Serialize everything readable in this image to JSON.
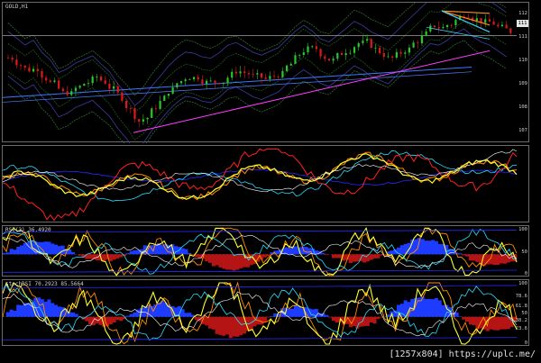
{
  "window": {
    "title": "GOLD,H1"
  },
  "chart_data": [
    {
      "type": "candlestick",
      "name": "price",
      "title": "GOLD,H1",
      "y_ticks": [
        "112",
        "111",
        "110",
        "109",
        "108",
        "107"
      ],
      "ylim": [
        106.6,
        112.3
      ],
      "last_price": "111",
      "close": [
        110.1,
        109.8,
        109.5,
        109.7,
        109.2,
        108.9,
        108.4,
        108.6,
        108.9,
        109.1,
        109.3,
        109.0,
        108.7,
        108.2,
        107.8,
        107.3,
        107.6,
        108.1,
        108.5,
        108.9,
        109.2,
        109.4,
        109.3,
        109.1,
        109.0,
        109.2,
        109.5,
        109.6,
        109.4,
        109.2,
        109.1,
        109.3,
        109.5,
        109.9,
        110.3,
        110.6,
        110.4,
        110.1,
        110.0,
        110.3,
        110.6,
        110.9,
        110.7,
        110.4,
        110.2,
        110.0,
        110.3,
        110.6,
        110.9,
        111.2,
        111.5,
        111.4,
        111.6,
        111.9,
        112.1,
        111.8,
        111.6,
        111.5,
        111.3,
        111.1
      ],
      "colors": {
        "up": "#28c828",
        "down": "#e01818",
        "trend": "#ff3cff",
        "arrow": "#ff8c1e",
        "channel": "#3c78ff"
      }
    },
    {
      "type": "line",
      "name": "oscillator-1",
      "title": "",
      "series": [
        {
          "color": "#ff2020"
        },
        {
          "color": "#ffff30"
        },
        {
          "color": "#ff8c00"
        },
        {
          "color": "#28dcff"
        },
        {
          "color": "#ffffff"
        },
        {
          "color": "#2828ff"
        }
      ]
    },
    {
      "type": "histogram+line",
      "name": "rsi",
      "title": "RSI(3) 36.4920",
      "y_ticks": [
        "100",
        "50",
        "0"
      ],
      "ylim": [
        0,
        100
      ]
    },
    {
      "type": "histogram+line",
      "name": "stochrsi",
      "title": "stochRSI 70.2923 85.5664",
      "y_ticks": [
        "100",
        "78.6",
        "61.8",
        "50",
        "38.2",
        "23.6",
        "0"
      ],
      "ylim": [
        0,
        100
      ]
    }
  ],
  "credit": "[1257x804] https://uplc.me/"
}
